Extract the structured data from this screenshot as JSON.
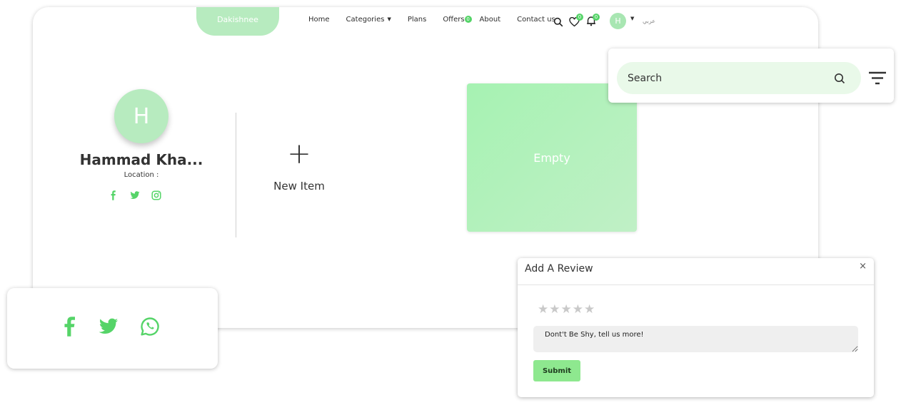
{
  "brand": {
    "logo_text": "Dakishnee",
    "accent": "#b7ebbf",
    "icon_green": "#55d468"
  },
  "nav": {
    "items": [
      {
        "label": "Home"
      },
      {
        "label": "Categories"
      },
      {
        "label": "Plans"
      },
      {
        "label": "Offers"
      },
      {
        "label": "About"
      },
      {
        "label": "Contact us"
      }
    ],
    "offers_badge": "0",
    "wishlist_badge": "0",
    "notifications_badge": "0",
    "avatar_initial": "H",
    "language_label": "عربي",
    "icons": [
      "search-icon",
      "heart-icon",
      "bell-icon",
      "chevron-down-icon"
    ]
  },
  "profile": {
    "initial": "H",
    "name": "Hammad Kha...",
    "location_label": "Location :",
    "socials": [
      "facebook-icon",
      "twitter-icon",
      "instagram-icon"
    ]
  },
  "new_item": {
    "label": "New Item"
  },
  "empty_card": {
    "label": "Empty"
  },
  "search": {
    "placeholder": "Search",
    "icons": [
      "search-icon",
      "filter-icon"
    ]
  },
  "share": {
    "icons": [
      "facebook-icon",
      "twitter-icon",
      "whatsapp-icon"
    ]
  },
  "review": {
    "title": "Add A Review",
    "close": "×",
    "stars": "★★★★★",
    "star_count": 5,
    "placeholder": "Dont't Be Shy, tell us more!",
    "submit_label": "Submit"
  }
}
